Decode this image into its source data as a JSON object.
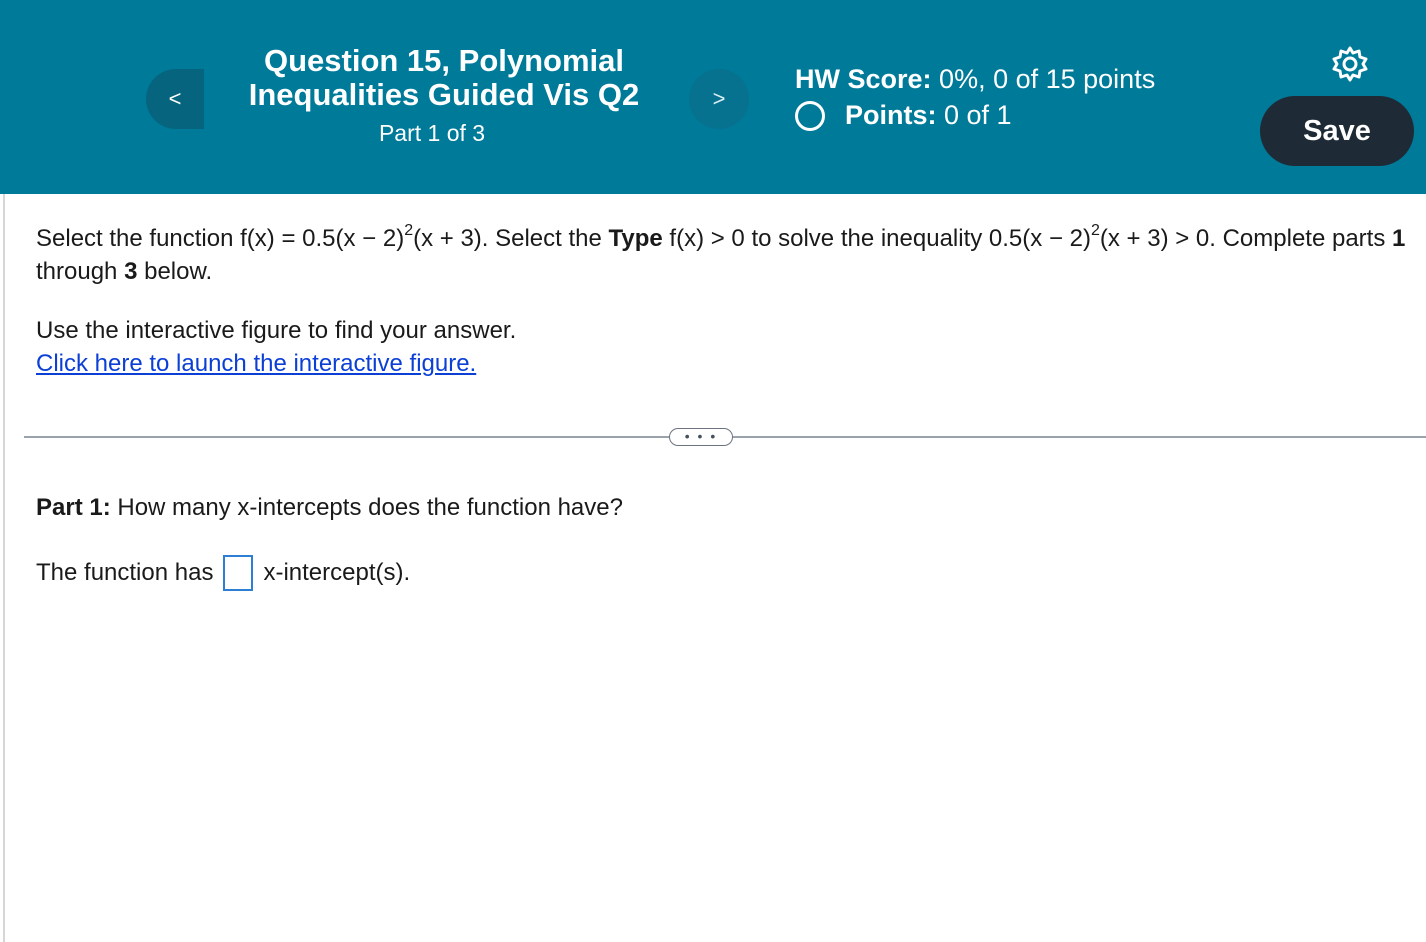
{
  "header": {
    "title": "Question 15, Polynomial Inequalities Guided Vis Q2",
    "part": "Part 1 of 3",
    "prev_icon": "chevron-left-icon",
    "next_icon": "chevron-right-icon",
    "prev_glyph": "<",
    "next_glyph": ">",
    "hw_score_label": "HW Score:",
    "hw_score_value": "0%, 0 of 15 points",
    "points_label": "Points:",
    "points_value": "0 of 1",
    "settings_icon": "gear-icon",
    "save_label": "Save",
    "colors": {
      "bar": "#007a99",
      "save_bg": "#1e2b36"
    }
  },
  "problem": {
    "p1": "Select the function f(x) = 0.5(x − 2)",
    "exp1": "2",
    "p2": "(x + 3). Select the ",
    "type_bold": "Type",
    "p3": " f(x) > 0 to solve the inequality 0.5(x − 2)",
    "exp2": "2",
    "p4": "(x + 3) > 0. Complete parts ",
    "b1": "1",
    "p5": " through ",
    "b3": "3",
    "p6": " below."
  },
  "instructions": {
    "line": "Use the interactive figure to find your answer.",
    "link": "Click here to launch the interactive figure."
  },
  "divider": {
    "more_label": "• • •"
  },
  "part1": {
    "label": "Part 1:",
    "question": " How many x-intercepts does the function have?",
    "answer_prefix": "The function has",
    "answer_value": "",
    "answer_suffix": "x-intercept(s)."
  }
}
